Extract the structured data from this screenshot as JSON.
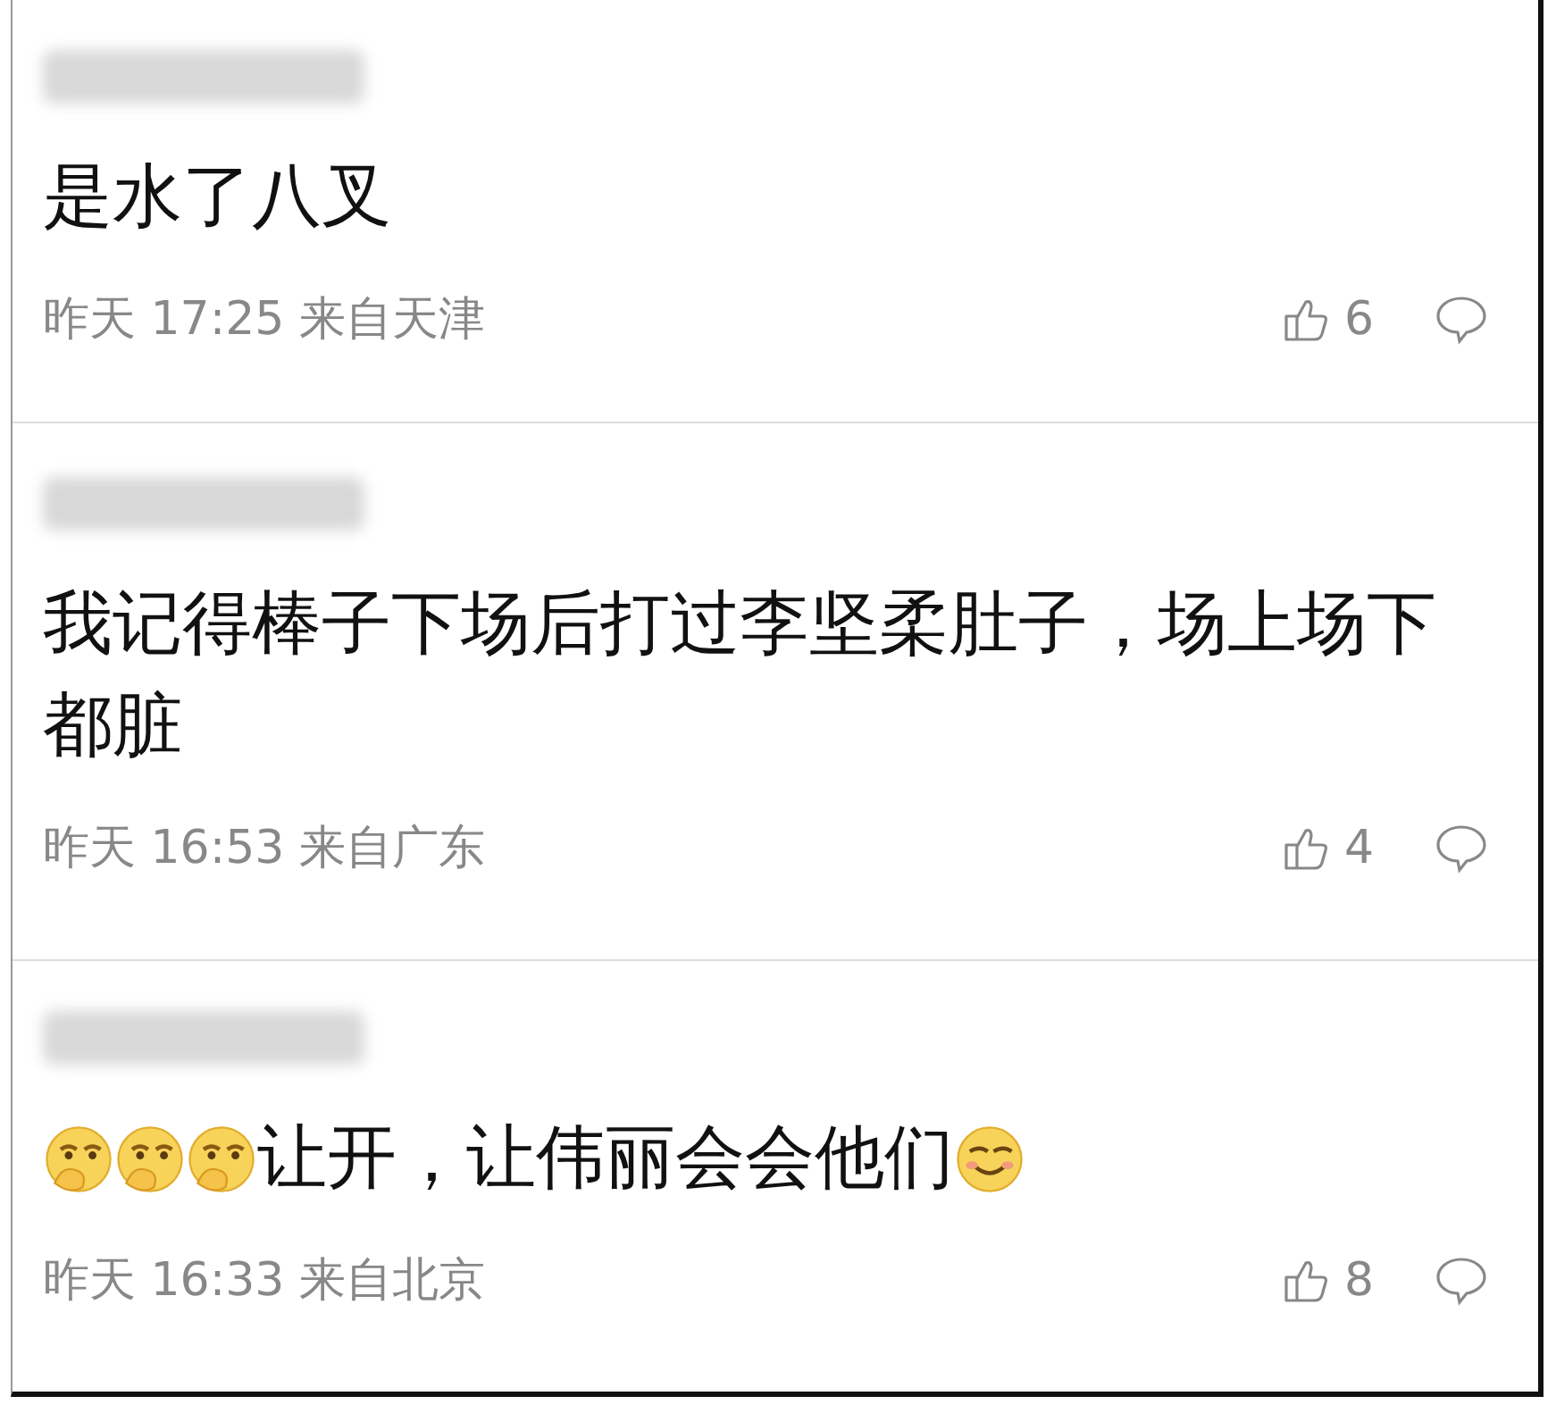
{
  "comments": [
    {
      "username_blurred": true,
      "content": [
        {
          "kind": "text",
          "text": "是水了八叉"
        }
      ],
      "time": "昨天 17:25 来自天津",
      "likes": "6"
    },
    {
      "username_blurred": true,
      "content": [
        {
          "kind": "text",
          "text": "我记得棒子下场后打过李坚柔肚子，场上场下都脏"
        }
      ],
      "time": "昨天 16:53 来自广东",
      "likes": "4"
    },
    {
      "username_blurred": true,
      "content": [
        {
          "kind": "thinker"
        },
        {
          "kind": "thinker"
        },
        {
          "kind": "thinker"
        },
        {
          "kind": "text",
          "text": "让开，让伟丽会会他们"
        },
        {
          "kind": "smiley"
        }
      ],
      "time": "昨天 16:33 来自北京",
      "likes": "8"
    }
  ]
}
